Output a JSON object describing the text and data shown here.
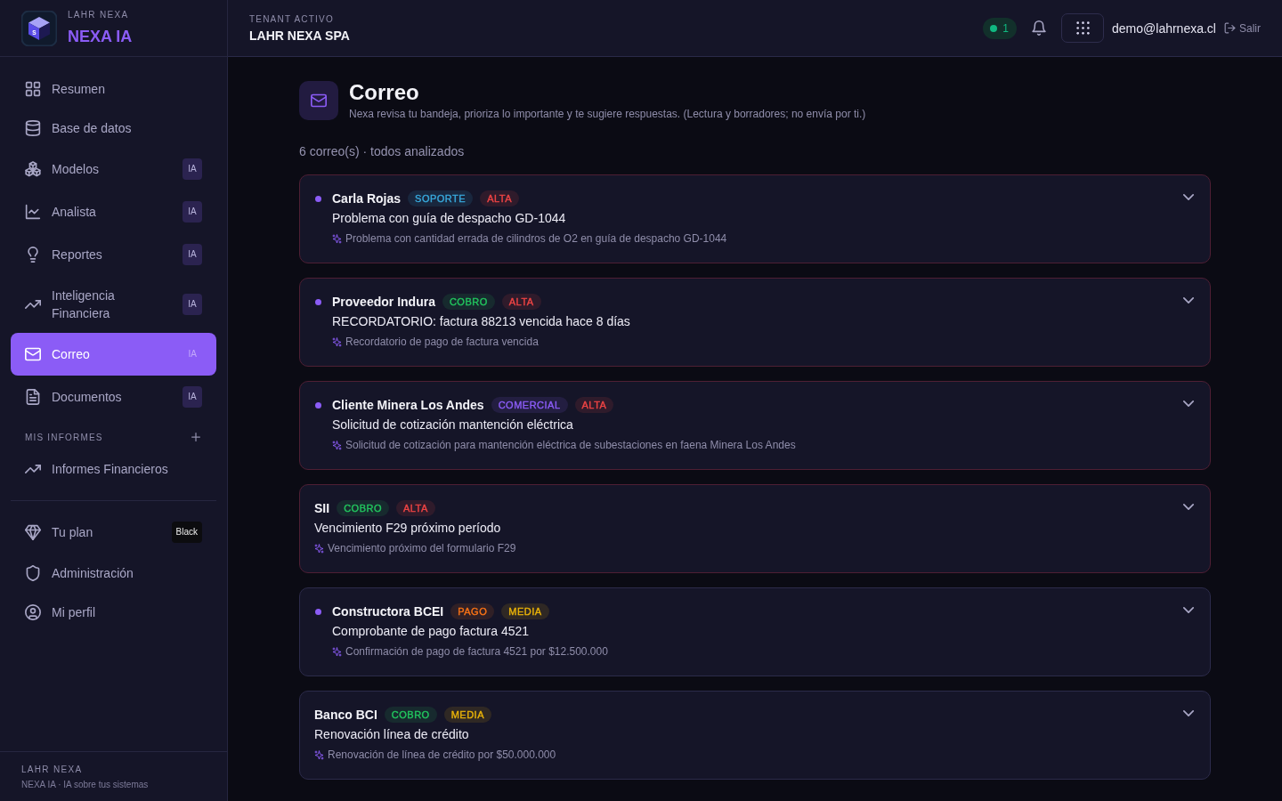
{
  "sidebar": {
    "brand": {
      "logo_letter": "S",
      "overline": "LAHR NEXA",
      "name": "NEXA IA"
    },
    "nav": [
      {
        "label": "Resumen",
        "selected": false
      },
      {
        "label": "Base de datos",
        "selected": false
      },
      {
        "label": "Modelos",
        "badge": {
          "kind": "ai",
          "text": "IA"
        },
        "selected": false
      },
      {
        "label": "Analista",
        "badge": {
          "kind": "ai",
          "text": "IA"
        },
        "selected": false
      },
      {
        "label": "Reportes",
        "badge": {
          "kind": "ai",
          "text": "IA"
        },
        "selected": false
      },
      {
        "label": "Inteligencia Financiera",
        "badge": {
          "kind": "ai",
          "text": "IA"
        },
        "selected": false
      },
      {
        "label": "Correo",
        "badge": {
          "kind": "ai",
          "text": "IA"
        },
        "selected": true
      },
      {
        "label": "Documentos",
        "badge": {
          "kind": "ai",
          "text": "IA"
        },
        "selected": false
      }
    ],
    "reports": {
      "title": "MIS INFORMES",
      "items": [
        {
          "label": "Informes Financieros",
          "selected": false
        }
      ]
    },
    "account": [
      {
        "label": "Tu plan",
        "badge": {
          "kind": "plan",
          "text": "Black"
        },
        "selected": false
      },
      {
        "label": "Administración",
        "selected": false
      },
      {
        "label": "Mi perfil",
        "selected": false
      }
    ],
    "footer": {
      "overline": "LAHR NEXA",
      "tagline": "NEXA IA · IA sobre tus sistemas"
    }
  },
  "header": {
    "tenant_label": "TENANT ACTIVO",
    "tenant_name": "LAHR NEXA SPA",
    "status": {
      "online": true,
      "count": "1"
    },
    "user_email": "demo@lahrnexa.cl",
    "logout": "Salir"
  },
  "page": {
    "title": "Correo",
    "subtitle": "Nexa revisa tu bandeja, prioriza lo importante y te sugiere respuestas. (Lectura y borradores; no envía por ti.)",
    "summary": "6 correo(s) · todos analizados",
    "emails": [
      {
        "unread": true,
        "urgent": true,
        "expanded": false,
        "sender": "Carla Rojas",
        "tags": [
          {
            "label": "SOPORTE",
            "color": "#38a9dc"
          },
          {
            "label": "ALTA",
            "color": "#ef4444"
          }
        ],
        "subject": "Problema con guía de despacho GD-1044",
        "summary": "Problema con cantidad errada de cilindros de O2 en guía de despacho GD-1044"
      },
      {
        "unread": true,
        "urgent": true,
        "expanded": false,
        "sender": "Proveedor Indura",
        "tags": [
          {
            "label": "COBRO",
            "color": "#22c55e"
          },
          {
            "label": "ALTA",
            "color": "#ef4444"
          }
        ],
        "subject": "RECORDATORIO: factura 88213 vencida hace 8 días",
        "summary": "Recordatorio de pago de factura vencida"
      },
      {
        "unread": true,
        "urgent": true,
        "expanded": false,
        "sender": "Cliente Minera Los Andes",
        "tags": [
          {
            "label": "COMERCIAL",
            "color": "#8b5cf6"
          },
          {
            "label": "ALTA",
            "color": "#ef4444"
          }
        ],
        "subject": "Solicitud de cotización mantención eléctrica",
        "summary": "Solicitud de cotización para mantención eléctrica de subestaciones en faena Minera Los Andes"
      },
      {
        "unread": false,
        "urgent": true,
        "expanded": false,
        "sender": "SII",
        "tags": [
          {
            "label": "COBRO",
            "color": "#22c55e"
          },
          {
            "label": "ALTA",
            "color": "#ef4444"
          }
        ],
        "subject": "Vencimiento F29 próximo período",
        "summary": "Vencimiento próximo del formulario F29"
      },
      {
        "unread": true,
        "urgent": false,
        "expanded": false,
        "sender": "Constructora BCEI",
        "tags": [
          {
            "label": "PAGO",
            "color": "#f97316"
          },
          {
            "label": "MEDIA",
            "color": "#eab308"
          }
        ],
        "subject": "Comprobante de pago factura 4521",
        "summary": "Confirmación de pago de factura 4521 por $12.500.000"
      },
      {
        "unread": false,
        "urgent": false,
        "expanded": false,
        "sender": "Banco BCI",
        "tags": [
          {
            "label": "COBRO",
            "color": "#22c55e"
          },
          {
            "label": "MEDIA",
            "color": "#eab308"
          }
        ],
        "subject": "Renovación línea de crédito",
        "summary": "Renovación de línea de crédito por $50.000.000"
      }
    ]
  }
}
